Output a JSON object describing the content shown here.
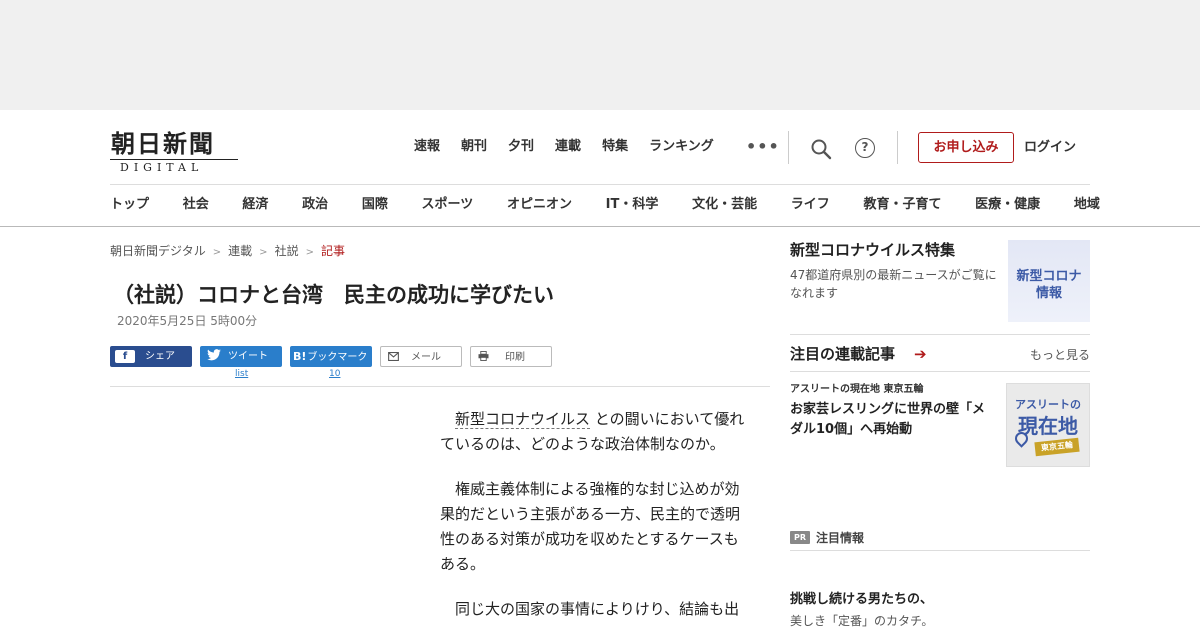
{
  "header": {
    "logo_jp": "朝日新聞",
    "logo_en": "DIGITAL",
    "top_nav": [
      "速報",
      "朝刊",
      "夕刊",
      "連載",
      "特集",
      "ランキング"
    ],
    "more_label": "•••",
    "help_label": "?",
    "subscribe_label": "お申し込み",
    "login_label": "ログイン"
  },
  "category_nav": [
    "トップ",
    "社会",
    "経済",
    "政治",
    "国際",
    "スポーツ",
    "オピニオン",
    "IT・科学",
    "文化・芸能",
    "ライフ",
    "教育・子育て",
    "医療・健康",
    "地域"
  ],
  "breadcrumb": {
    "items": [
      "朝日新聞デジタル",
      "連載",
      "社説"
    ],
    "current": "記事",
    "separator": ">"
  },
  "article": {
    "title": "（社説）コロナと台湾　民主の成功に学びたい",
    "date": "2020年5月25日 5時00分",
    "keyword": "新型コロナウイルス",
    "p1_rest": "との闘いにおいて優れているのは、どのような政治体制なのか。",
    "p2": "権威主義体制による強権的な封じ込めが効果的だという主張がある一方、民主的で透明性のある対策が成功を収めたとするケースもある。",
    "p3": "同じ大の国家の事情によりけり、結論も出"
  },
  "share": {
    "facebook": "シェア",
    "twitter": "ツイート",
    "twitter_count": "list",
    "hatena": "ブックマーク",
    "hatena_icon": "B!",
    "hatena_count": "10",
    "mail": "メール",
    "print": "印刷"
  },
  "sidebar": {
    "feature": {
      "title": "新型コロナウイルス特集",
      "desc": "47都道府県別の最新ニュースがご覧になれます",
      "thumb_line1": "新型コロナ",
      "thumb_line2": "情報"
    },
    "series": {
      "title": "注目の連載記事",
      "arrow": "➔",
      "more": "もっと見る",
      "kicker": "アスリートの現在地 東京五輪",
      "headline": "お家芸レスリングに世界の壁「メダル10個」へ再始動",
      "thumb_line1": "アスリートの",
      "thumb_line2": "現在地",
      "thumb_badge": "東京五輪"
    },
    "pr": {
      "badge": "PR",
      "label": "注目情報",
      "title": "挑戦し続ける男たちの、",
      "sub": "美しき「定番」のカタチ。"
    }
  },
  "colors": {
    "accent_red": "#b01b1b",
    "facebook_blue": "#2a4d8f",
    "twitter_blue": "#2a7ecb"
  }
}
